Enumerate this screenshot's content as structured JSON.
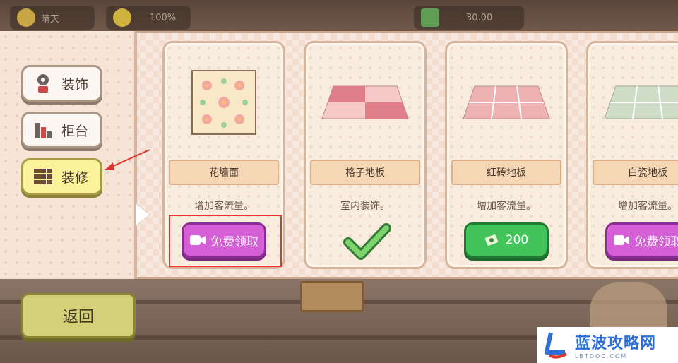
{
  "hud": {
    "left_label": "晴天",
    "mood": "100%",
    "money": "30.00"
  },
  "categories": [
    {
      "label": "装饰",
      "icon": "flower-pot-icon",
      "active": false
    },
    {
      "label": "柜台",
      "icon": "counter-icon",
      "active": false
    },
    {
      "label": "装修",
      "icon": "tiles-icon",
      "active": true
    }
  ],
  "items": [
    {
      "name": "花墙面",
      "desc": "增加客流量。",
      "action": "video",
      "action_label": "免费领取"
    },
    {
      "name": "格子地板",
      "desc": "室内装饰。",
      "action": "owned",
      "action_label": ""
    },
    {
      "name": "红砖地板",
      "desc": "增加客流量。",
      "action": "cash",
      "action_label": "200"
    },
    {
      "name": "白瓷地板",
      "desc": "增加客流量。",
      "action": "video",
      "action_label": "免费领取"
    }
  ],
  "back_label": "返回",
  "watermark": {
    "cn": "蓝波攻略网",
    "en": "LBTDOC.COM"
  },
  "colors": {
    "video_button": "#d45fd6",
    "cash_button": "#43c45a",
    "active_tab": "#fbf39a",
    "highlight": "#e0342c"
  }
}
